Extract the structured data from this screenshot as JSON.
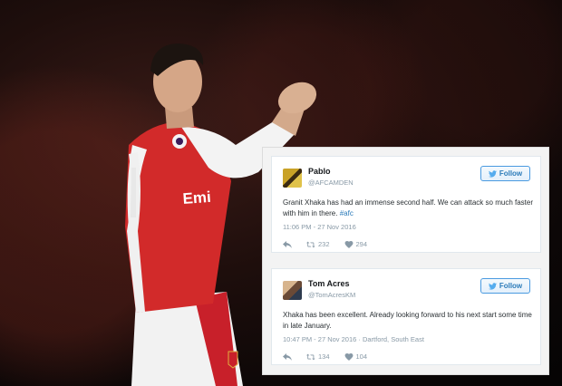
{
  "tweets": [
    {
      "name": "Pablo",
      "handle": "@AFCAMDEN",
      "follow_label": "Follow",
      "text": "Granit Xhaka has had an immense second half. We can attack so much faster with him in there.",
      "hashtag": "#afc",
      "meta": "11:06 PM - 27 Nov 2016",
      "retweets": "232",
      "likes": "294"
    },
    {
      "name": "Tom Acres",
      "handle": "@TomAcresKM",
      "follow_label": "Follow",
      "text": "Xhaka has been excellent. Already looking forward to his next start some time in late January.",
      "hashtag": "",
      "meta": "10:47 PM - 27 Nov 2016 · Dartford, South East",
      "retweets": "134",
      "likes": "104"
    }
  ],
  "photo": {
    "shirt_text": "Emi",
    "shirt_color": "#d22a2a",
    "background_color": "#1a0c0a"
  },
  "icons": {
    "reply": "reply-icon",
    "retweet": "retweet-icon",
    "like": "heart-icon",
    "twitter": "twitter-bird-icon"
  }
}
